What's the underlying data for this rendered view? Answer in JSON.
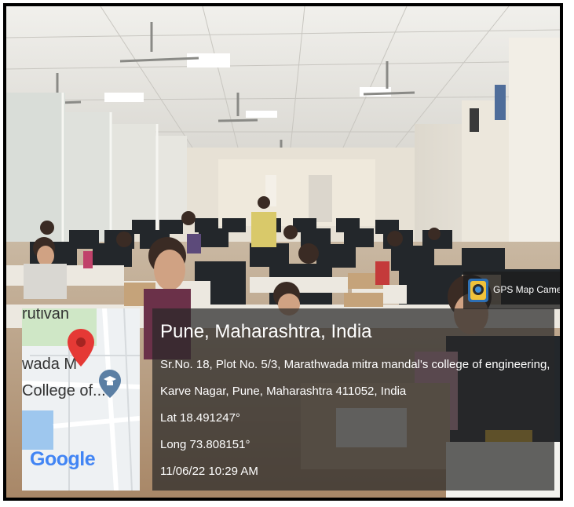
{
  "scene": {
    "description_icon": "computer-lab-photo",
    "colors": {
      "wall": "#e8e2d6",
      "ceiling": "#ecebe6",
      "monitor": "#1c1f22",
      "desk": "#d9d2c5",
      "floor": "#b79a7c"
    }
  },
  "gps_badge": {
    "label": "GPS Map Camera",
    "icon": "gps-map-camera-icon"
  },
  "map": {
    "labels": [
      "rutivan",
      "wada M",
      "College of..."
    ],
    "google_logo": "Google",
    "pin_icon": "map-pin-icon",
    "poi_icon": "graduation-cap-icon"
  },
  "location": {
    "title": "Pune, Maharashtra, India",
    "address_line1": "Sr.No. 18, Plot No. 5/3, Marathwada mitra mandal's college of engineering,",
    "address_line2": "Karve Nagar, Pune, Maharashtra 411052, India",
    "lat": "Lat 18.491247°",
    "long": "Long 73.808151°",
    "datetime": "11/06/22 10:29 AM"
  }
}
